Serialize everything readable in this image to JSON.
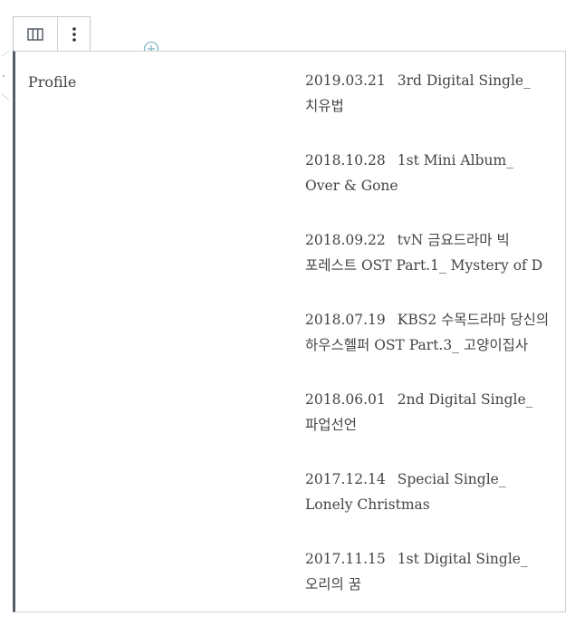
{
  "toolbar": {
    "buttons": [
      {
        "icon": "columns-icon"
      },
      {
        "icon": "more-vertical-icon"
      }
    ]
  },
  "block": {
    "left_label": "Profile",
    "entries": [
      {
        "date": "2019.03.21",
        "title": "3rd Digital Single_ 치유법"
      },
      {
        "date": "2018.10.28",
        "title": "1st Mini Album_ Over & Gone"
      },
      {
        "date": "2018.09.22",
        "title": "tvN 금요드라마 빅 포레스트 OST Part.1_ Mystery of D"
      },
      {
        "date": "2018.07.19",
        "title": "KBS2 수목드라마 당신의 하우스헬퍼 OST Part.3_ 고양이집사"
      },
      {
        "date": "2018.06.01",
        "title": "2nd Digital Single_ 파업선언"
      },
      {
        "date": "2017.12.14",
        "title": "Special Single_ Lonely Christmas"
      },
      {
        "date": "2017.11.15",
        "title": "1st Digital Single_ 오리의 꿈"
      }
    ]
  },
  "colors": {
    "block_accent": "#555d66",
    "border": "#d0d0d0",
    "text": "#444444",
    "inserter": "#7fb6c8"
  }
}
